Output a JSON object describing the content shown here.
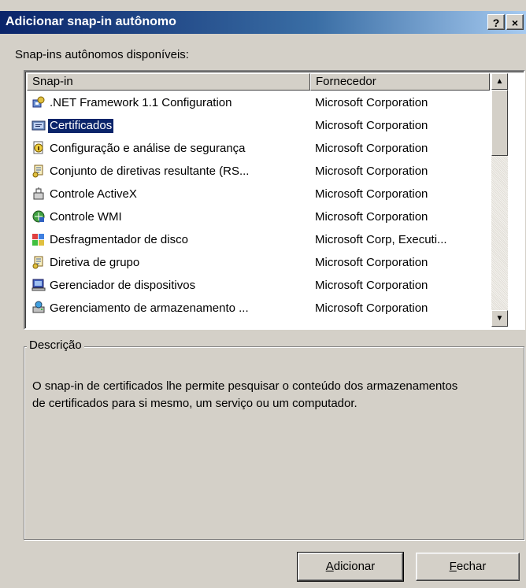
{
  "window": {
    "title": "Adicionar snap-in autônomo",
    "help_glyph": "?",
    "close_glyph": "×"
  },
  "list": {
    "label": "Snap-ins autônomos disponíveis:",
    "columns": [
      "Snap-in",
      "Fornecedor"
    ],
    "rows": [
      {
        "name": ".NET Framework 1.1 Configuration",
        "vendor": "Microsoft Corporation",
        "icon": "dotnet-config-icon"
      },
      {
        "name": "Certificados",
        "vendor": "Microsoft Corporation",
        "icon": "certificates-icon",
        "selected": true
      },
      {
        "name": "Configuração e análise de segurança",
        "vendor": "Microsoft Corporation",
        "icon": "security-analysis-icon"
      },
      {
        "name": "Conjunto de diretivas resultante (RS...",
        "vendor": "Microsoft Corporation",
        "icon": "policy-scroll-icon"
      },
      {
        "name": "Controle ActiveX",
        "vendor": "Microsoft Corporation",
        "icon": "activex-icon"
      },
      {
        "name": "Controle WMI",
        "vendor": "Microsoft Corporation",
        "icon": "wmi-icon"
      },
      {
        "name": "Desfragmentador de disco",
        "vendor": "Microsoft Corp, Executi...",
        "icon": "defrag-icon"
      },
      {
        "name": "Diretiva de grupo",
        "vendor": "Microsoft Corporation",
        "icon": "group-policy-icon"
      },
      {
        "name": "Gerenciador de dispositivos",
        "vendor": "Microsoft Corporation",
        "icon": "device-manager-icon"
      },
      {
        "name": "Gerenciamento de armazenamento ...",
        "vendor": "Microsoft Corporation",
        "icon": "storage-management-icon"
      }
    ]
  },
  "description": {
    "label": "Descrição",
    "text": "O snap-in de certificados lhe permite pesquisar o conteúdo dos armazenamentos de certificados para si mesmo, um serviço ou um computador."
  },
  "buttons": {
    "add_accel": "A",
    "add_rest": "dicionar",
    "close_accel": "F",
    "close_rest": "echar"
  }
}
